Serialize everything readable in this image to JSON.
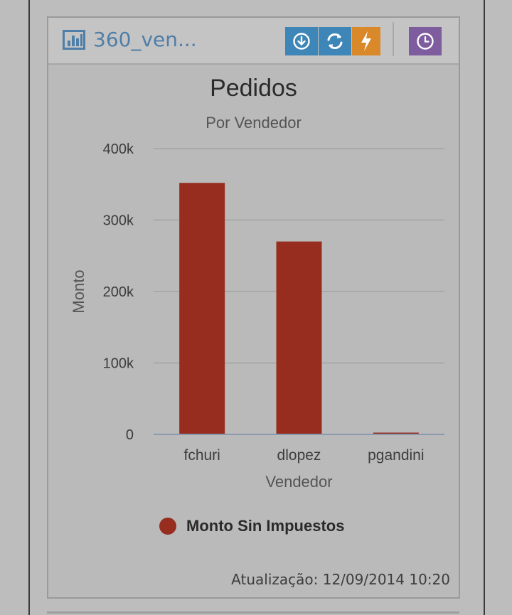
{
  "panel": {
    "title": "360_ven...",
    "buttons": [
      {
        "name": "download-button",
        "icon": "download-icon",
        "color": "#3e86b8"
      },
      {
        "name": "refresh-button",
        "icon": "refresh-icon",
        "color": "#3e86b8"
      },
      {
        "name": "lightning-button",
        "icon": "lightning-icon",
        "color": "#d9882a"
      },
      {
        "name": "clock-button",
        "icon": "clock-icon",
        "color": "#7e5d9f"
      }
    ],
    "footer": "Atualização: 12/09/2014 10:20"
  },
  "chart_data": {
    "type": "bar",
    "title": "Pedidos",
    "subtitle": "Por Vendedor",
    "xlabel": "Vendedor",
    "ylabel": "Monto",
    "categories": [
      "fchuri",
      "dlopez",
      "pgandini"
    ],
    "series": [
      {
        "name": "Monto Sin Impuestos",
        "values": [
          352000,
          270000,
          2500
        ],
        "color": "#962d1e"
      }
    ],
    "ylim": [
      0,
      400000
    ],
    "yticks": [
      0,
      100000,
      200000,
      300000,
      400000
    ],
    "ytick_labels": [
      "0",
      "100k",
      "200k",
      "300k",
      "400k"
    ],
    "grid": true,
    "legend": "bottom"
  }
}
